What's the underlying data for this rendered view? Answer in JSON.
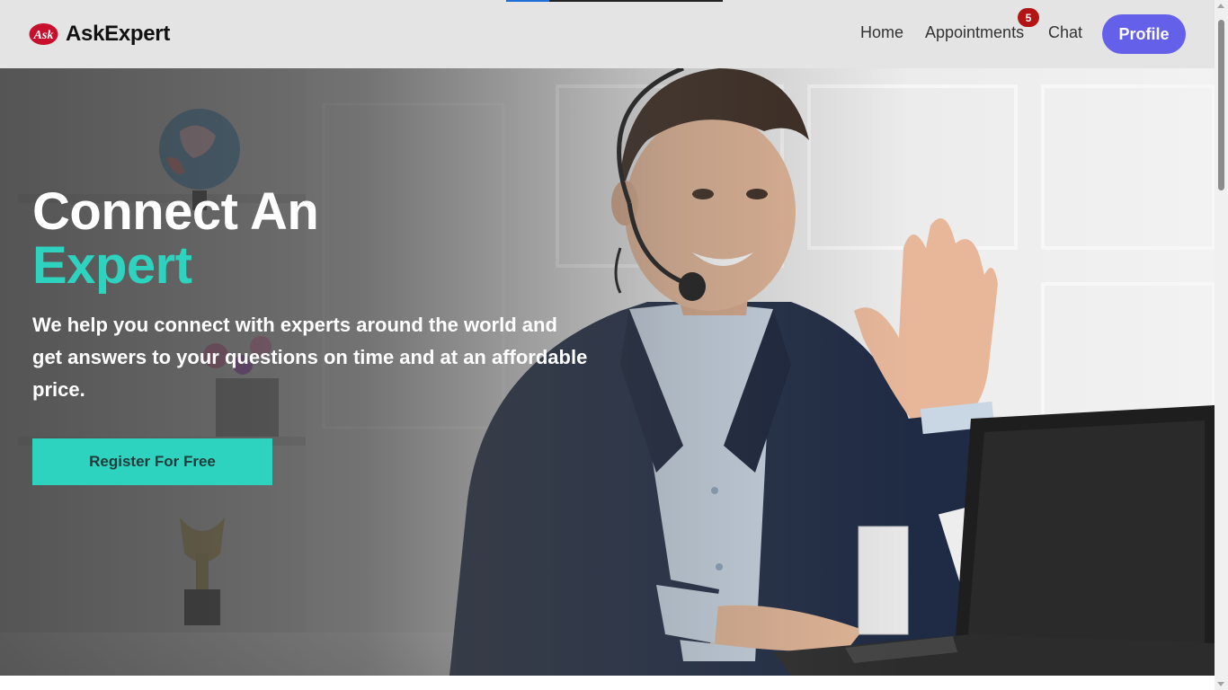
{
  "brand": {
    "logo_text": "Ask",
    "name": "AskExpert",
    "logo_color": "#c8102e"
  },
  "nav": {
    "home": "Home",
    "appointments": "Appointments",
    "appointments_badge": "5",
    "chat": "Chat",
    "profile": "Profile"
  },
  "hero": {
    "title_line1": "Connect An",
    "title_line2": "Expert",
    "subtitle": "We help you connect with experts around the world and get answers to your questions on time and at an affordable price.",
    "cta": "Register For Free"
  },
  "colors": {
    "accent": "#2ed3bf",
    "profile_button": "#6460ea",
    "badge": "#b31515",
    "navbar_bg": "#e4e4e4"
  }
}
